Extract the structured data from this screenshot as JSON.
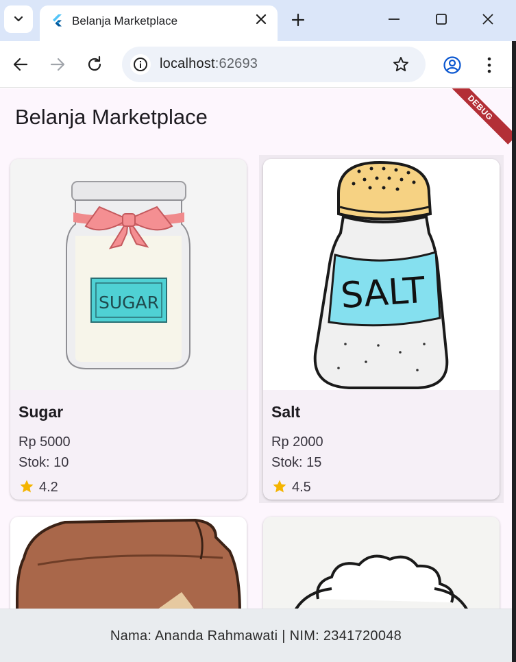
{
  "browser": {
    "tab_title": "Belanja Marketplace",
    "url_host": "localhost",
    "url_port": ":62693"
  },
  "app": {
    "title": "Belanja Marketplace",
    "debug_label": "DEBUG"
  },
  "products": [
    {
      "name": "Sugar",
      "price": "Rp 5000",
      "stock": "Stok: 10",
      "rating": "4.2",
      "image_label": "SUGAR"
    },
    {
      "name": "Salt",
      "price": "Rp 2000",
      "stock": "Stok: 15",
      "rating": "4.5",
      "image_label": "SALT"
    }
  ],
  "footer": {
    "text": "Nama: Ananda Rahmawati | NIM: 2341720048"
  },
  "colors": {
    "tabbar": "#dbe6f9",
    "app_bg": "#fdf6fd",
    "card_bg": "#f6f0f7",
    "star": "#f4b400",
    "debug": "#b32f36"
  }
}
